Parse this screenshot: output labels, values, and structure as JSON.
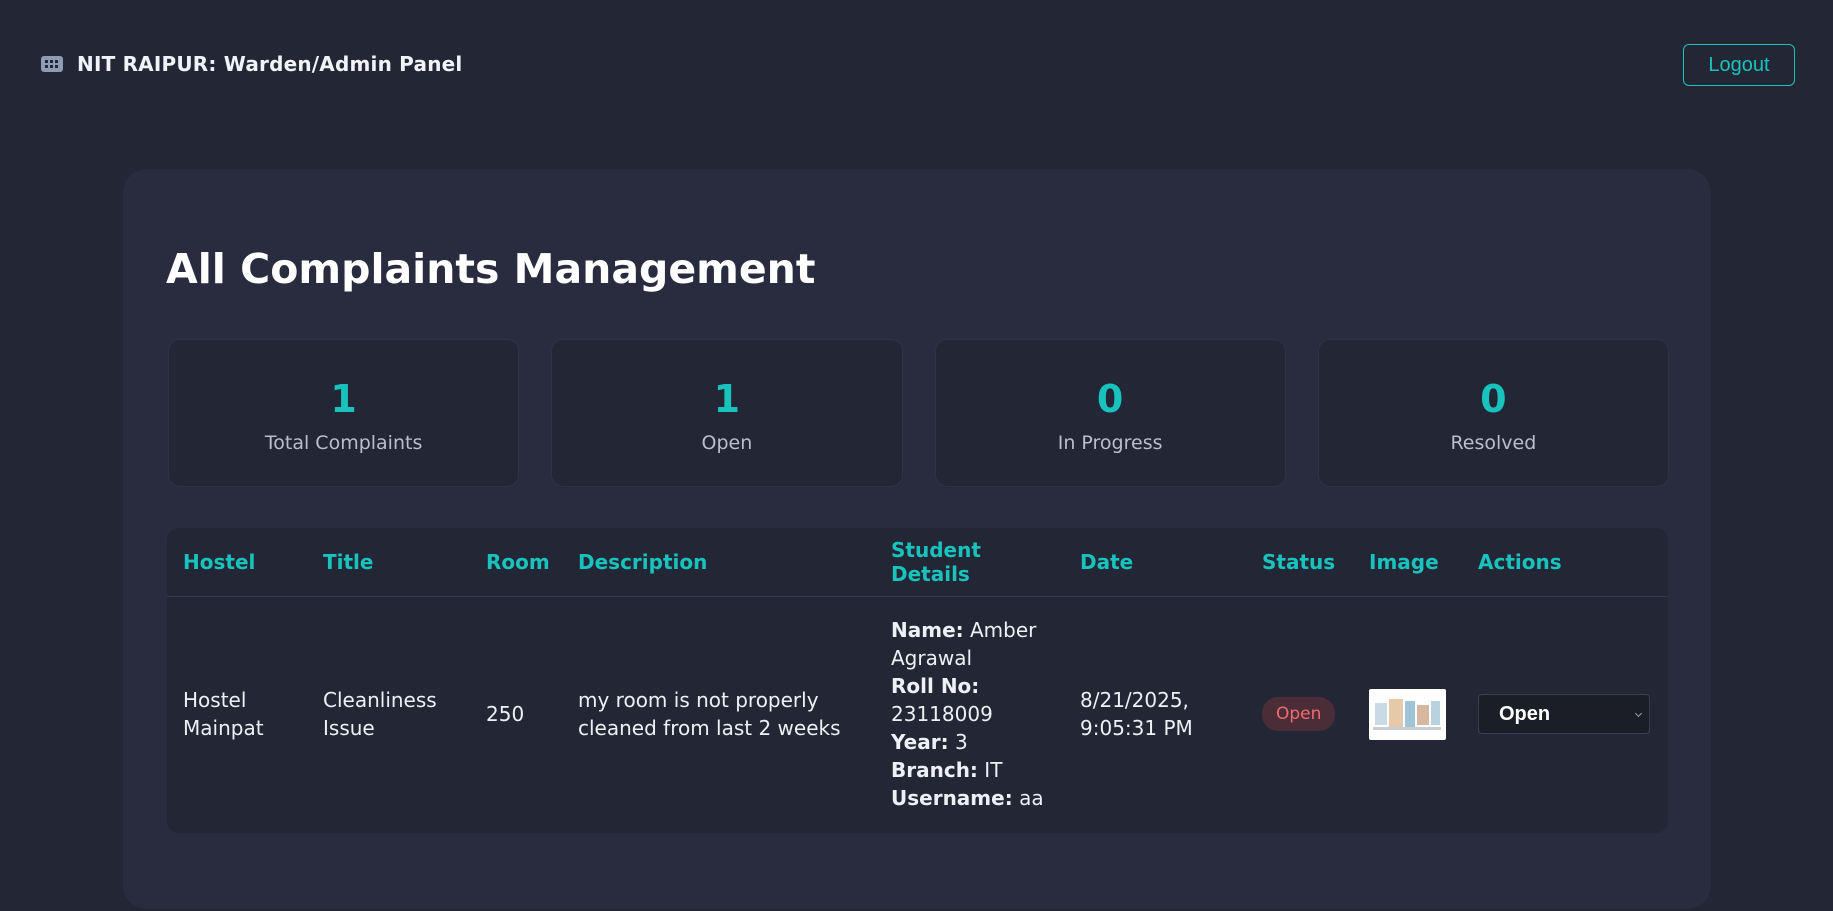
{
  "header": {
    "title": "NIT RAIPUR: Warden/Admin Panel",
    "icon": "building-icon",
    "logout_label": "Logout"
  },
  "main": {
    "title": "All Complaints Management",
    "stats": [
      {
        "value": "1",
        "label": "Total Complaints"
      },
      {
        "value": "1",
        "label": "Open"
      },
      {
        "value": "0",
        "label": "In Progress"
      },
      {
        "value": "0",
        "label": "Resolved"
      }
    ]
  },
  "table": {
    "columns": [
      "Hostel",
      "Title",
      "Room",
      "Description",
      "Student Details",
      "Date",
      "Status",
      "Image",
      "Actions"
    ],
    "rows": [
      {
        "hostel": "Hostel Mainpat",
        "title": "Cleanliness Issue",
        "room": "250",
        "description": "my room is not properly cleaned from last 2 weeks",
        "student": {
          "name_label": "Name:",
          "name": "Amber Agrawal",
          "roll_label": "Roll No:",
          "roll": "23118009",
          "year_label": "Year:",
          "year": "3",
          "branch_label": "Branch:",
          "branch": "IT",
          "username_label": "Username:",
          "username": "aa"
        },
        "date": "8/21/2025, 9:05:31 PM",
        "status": "Open",
        "action_value": "Open"
      }
    ]
  },
  "colors": {
    "accent": "#19c3bd",
    "background": "#232634",
    "panel": "#292c3f",
    "status_open_text": "#f06b73",
    "status_open_bg": "#4a2d36"
  }
}
